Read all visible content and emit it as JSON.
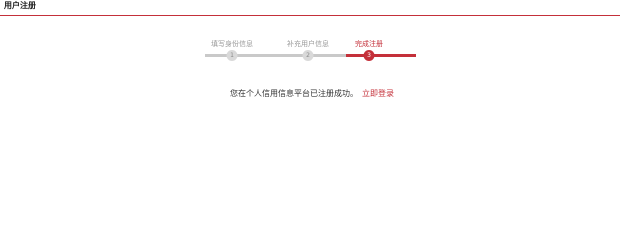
{
  "header": {
    "title": "用户注册"
  },
  "steps": [
    {
      "label": "填写身份信息",
      "number": "1",
      "state": "done"
    },
    {
      "label": "补充用户信息",
      "number": "2",
      "state": "done"
    },
    {
      "label": "完成注册",
      "number": "3",
      "state": "current"
    }
  ],
  "message": {
    "text": "您在个人信用信息平台已注册成功。",
    "login_link": "立即登录"
  },
  "colors": {
    "accent": "#c4303a",
    "inactive_track": "#c9c9c9",
    "muted_text": "#9a9a9a"
  }
}
